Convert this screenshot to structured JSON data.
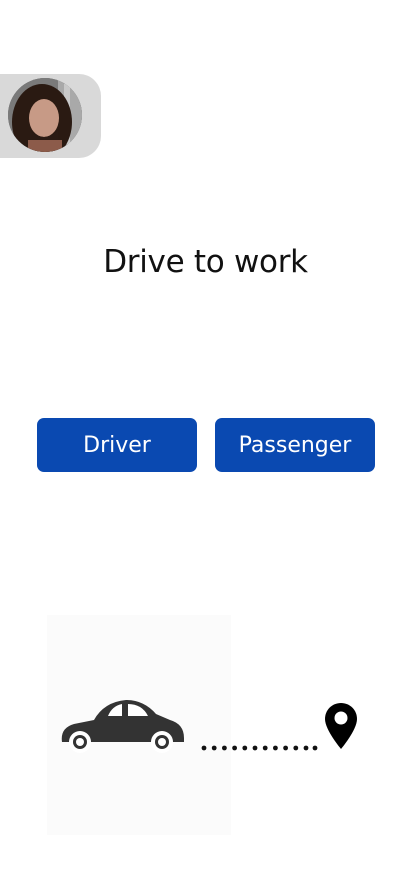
{
  "profile": {
    "avatar_icon": "user-avatar-photo"
  },
  "header": {
    "title": "Drive to work"
  },
  "roles": {
    "driver_label": "Driver",
    "passenger_label": "Passenger"
  },
  "illustration": {
    "car_icon": "car-icon",
    "route_icon": "dotted-route",
    "destination_icon": "location-pin-icon"
  },
  "colors": {
    "primary_button": "#0a49b1",
    "profile_tab": "#d9d9d9"
  }
}
